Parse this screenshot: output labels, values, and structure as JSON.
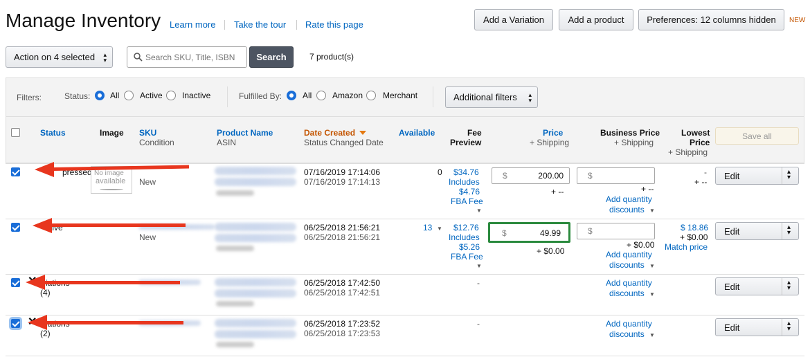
{
  "header": {
    "title": "Manage Inventory",
    "links": [
      "Learn more",
      "Take the tour",
      "Rate this page"
    ],
    "buttons": {
      "add_variation": "Add a Variation",
      "add_product": "Add a product",
      "preferences": "Preferences: 12 columns hidden"
    },
    "new_badge": "NEW"
  },
  "toolbar": {
    "action": "Action on 4 selected",
    "search_placeholder": "Search SKU, Title, ISBN",
    "search_button": "Search",
    "product_count": "7 product(s)"
  },
  "filters": {
    "label": "Filters:",
    "status_label": "Status:",
    "status_options": [
      "All",
      "Active",
      "Inactive"
    ],
    "fulfilled_label": "Fulfilled By:",
    "fulfilled_options": [
      "All",
      "Amazon",
      "Merchant"
    ],
    "additional": "Additional filters"
  },
  "columns": {
    "status": "Status",
    "image": "Image",
    "sku": "SKU",
    "condition": "Condition",
    "product_name": "Product Name",
    "asin": "ASIN",
    "date_created": "Date Created",
    "status_changed": "Status Changed Date",
    "available": "Available",
    "fee": "Fee",
    "preview": "Preview",
    "price": "Price",
    "price_shipping": "+ Shipping",
    "business_price": "Business Price",
    "business_shipping": "+ Shipping",
    "lowest": "Lowest",
    "lowest_price": "Price",
    "lowest_shipping": "+ Shipping",
    "save_all": "Save all"
  },
  "rows": [
    {
      "status_partial": "pressed",
      "no_image": "No image",
      "available_text": "available",
      "condition": "New",
      "date1": "07/16/2019 17:14:06",
      "date2": "07/16/2019 17:14:13",
      "available": "0",
      "fee": "$34.76",
      "fee_inc": "Includes",
      "fba": "$4.76",
      "fba_label": "FBA Fee",
      "price_cur": "$",
      "price": "200.00",
      "price_ship": "+ --",
      "bp_cur": "$",
      "bp_ship": "+ --",
      "bp_link": "Add quantity",
      "bp_link2": "discounts",
      "lowest_a": "-",
      "lowest_b": "+ --",
      "edit": "Edit"
    },
    {
      "status_partial": "tive",
      "condition": "New",
      "date1": "06/25/2018 21:56:21",
      "date2": "06/25/2018 21:56:21",
      "available": "13",
      "fee": "$12.76",
      "fee_inc": "Includes",
      "fba": "$5.26",
      "fba_label": "FBA Fee",
      "price_cur": "$",
      "price": "49.99",
      "price_ship": "+ $0.00",
      "bp_cur": "$",
      "bp_ship": "+ $0.00",
      "bp_link": "Add quantity",
      "bp_link2": "discounts",
      "lowest_a": "$ 18.86",
      "lowest_b": "+ $0.00",
      "lowest_c": "Match price",
      "edit": "Edit"
    },
    {
      "status_partial": "riations",
      "count": "(4)",
      "date1": "06/25/2018 17:42:50",
      "date2": "06/25/2018 17:42:51",
      "fee": "-",
      "bp_link": "Add quantity",
      "bp_link2": "discounts",
      "edit": "Edit"
    },
    {
      "status_partial": "riations",
      "count": "(2)",
      "date1": "06/25/2018 17:23:52",
      "date2": "06/25/2018 17:23:53",
      "fee": "-",
      "bp_link": "Add quantity",
      "bp_link2": "discounts",
      "edit": "Edit"
    }
  ],
  "colors": {
    "link": "#0066c0",
    "accent_orange": "#c45500",
    "arrow": "#e8361e",
    "highlight_border": "#2b8a3e",
    "checkbox": "#1a6ed8"
  }
}
